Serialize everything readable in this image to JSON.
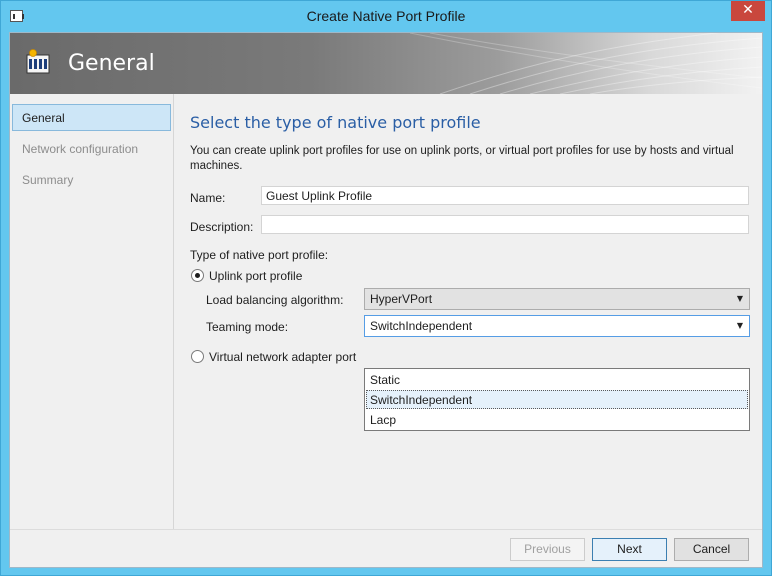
{
  "window": {
    "title": "Create Native Port Profile",
    "close_glyph": "✕"
  },
  "banner": {
    "title": "General",
    "icon": "port-profile-icon"
  },
  "nav": {
    "items": [
      {
        "label": "General",
        "active": true
      },
      {
        "label": "Network configuration",
        "active": false
      },
      {
        "label": "Summary",
        "active": false
      }
    ]
  },
  "main": {
    "heading": "Select the type of native port profile",
    "description": "You can create uplink port profiles for use on uplink ports, or virtual port profiles for use by hosts and virtual machines.",
    "name_label": "Name:",
    "name_value": "Guest Uplink Profile",
    "description_label": "Description:",
    "description_value": "",
    "type_label": "Type of native port profile:",
    "uplink_radio_label": "Uplink port profile",
    "uplink_selected": true,
    "load_balancing_label": "Load balancing algorithm:",
    "load_balancing_value": "HyperVPort",
    "teaming_label": "Teaming mode:",
    "teaming_value": "SwitchIndependent",
    "teaming_options": [
      "Static",
      "SwitchIndependent",
      "Lacp"
    ],
    "teaming_highlighted": "SwitchIndependent",
    "virtual_radio_label": "Virtual network adapter port"
  },
  "footer": {
    "previous_label": "Previous",
    "next_label": "Next",
    "cancel_label": "Cancel"
  },
  "colors": {
    "titlebar": "#63c7ef",
    "heading": "#2a5ea5",
    "close": "#c9473d",
    "nav_active_bg": "#cde6f7"
  }
}
